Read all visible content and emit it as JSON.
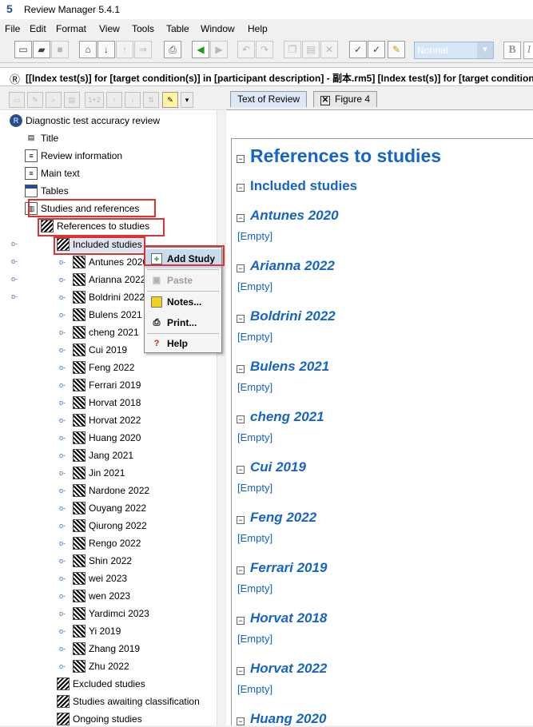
{
  "window": {
    "logo": "5",
    "title": "Review Manager 5.4.1"
  },
  "menubar": {
    "items": [
      {
        "label": "File"
      },
      {
        "label": "Edit"
      },
      {
        "label": "Format"
      },
      {
        "label": "View"
      },
      {
        "label": "Tools"
      },
      {
        "label": "Table"
      },
      {
        "label": "Window"
      },
      {
        "label": "Help"
      }
    ]
  },
  "toolbar": {
    "style_combo_value": "Normal",
    "bold_label": "B",
    "italic_label": "I",
    "icons": [
      "new-document-icon",
      "open-folder-icon",
      "save-icon",
      "home-icon",
      "import-icon",
      "export-icon",
      "forward-icon",
      "print-icon",
      "back-arrow-icon",
      "forward-arrow-icon",
      "undo-icon",
      "redo-icon",
      "copy-icon",
      "paste-icon",
      "delete-icon",
      "spell-check-icon",
      "spell-check-abc-icon",
      "notes-icon"
    ]
  },
  "document_header": {
    "title": "[[Index test(s)] for [target condition(s)] in [participant description] - 副本.rm5] [Index test(s)] for [target condition(s)"
  },
  "tree_toolbar": {
    "number_button_label": "1+2"
  },
  "tree": {
    "root": "Diagnostic test accuracy review",
    "nodes": [
      {
        "label": "Title"
      },
      {
        "label": "Review information"
      },
      {
        "label": "Main text"
      },
      {
        "label": "Tables"
      },
      {
        "label": "Studies and references"
      },
      {
        "label": "References to studies"
      },
      {
        "label": "Included studies"
      }
    ],
    "studies": [
      "Antunes 2020",
      "Arianna 2022",
      "Boldrini 2022",
      "Bulens 2021",
      "cheng 2021",
      "Cui 2019",
      "Feng 2022",
      "Ferrari 2019",
      "Horvat 2018",
      "Horvat 2022",
      "Huang 2020",
      "Jang 2021",
      "Jin 2021",
      "Nardone 2022",
      "Ouyang 2022",
      "Qiurong 2022",
      "Rengo 2022",
      "Shin 2022",
      "wei 2023",
      "wen 2023",
      "Yardimci 2023",
      "Yi 2019",
      "Zhang 2019",
      "Zhu 2022"
    ],
    "other_categories": [
      "Excluded studies",
      "Studies awaiting classification",
      "Ongoing studies"
    ]
  },
  "context_menu": {
    "items": [
      {
        "label": "Add Study",
        "enabled": true,
        "highlighted": true
      },
      {
        "label": "Paste",
        "enabled": false
      },
      {
        "label": "Notes...",
        "enabled": true
      },
      {
        "label": "Print...",
        "enabled": true
      },
      {
        "label": "Help",
        "enabled": true
      }
    ]
  },
  "tabs": [
    {
      "label": "Text of Review",
      "active": true
    },
    {
      "label": "Figure 4",
      "active": false
    }
  ],
  "document": {
    "heading": "References to studies",
    "subheading": "Included studies",
    "empty_label": "[Empty]",
    "studies": [
      "Antunes 2020",
      "Arianna 2022",
      "Boldrini 2022",
      "Bulens 2021",
      "cheng 2021",
      "Cui 2019",
      "Feng 2022",
      "Ferrari 2019",
      "Horvat 2018",
      "Horvat 2022",
      "Huang 2020"
    ]
  },
  "colors": {
    "accent": "#1464c8",
    "highlight_border": "#e03030",
    "tab_active": "#dce8f5"
  }
}
